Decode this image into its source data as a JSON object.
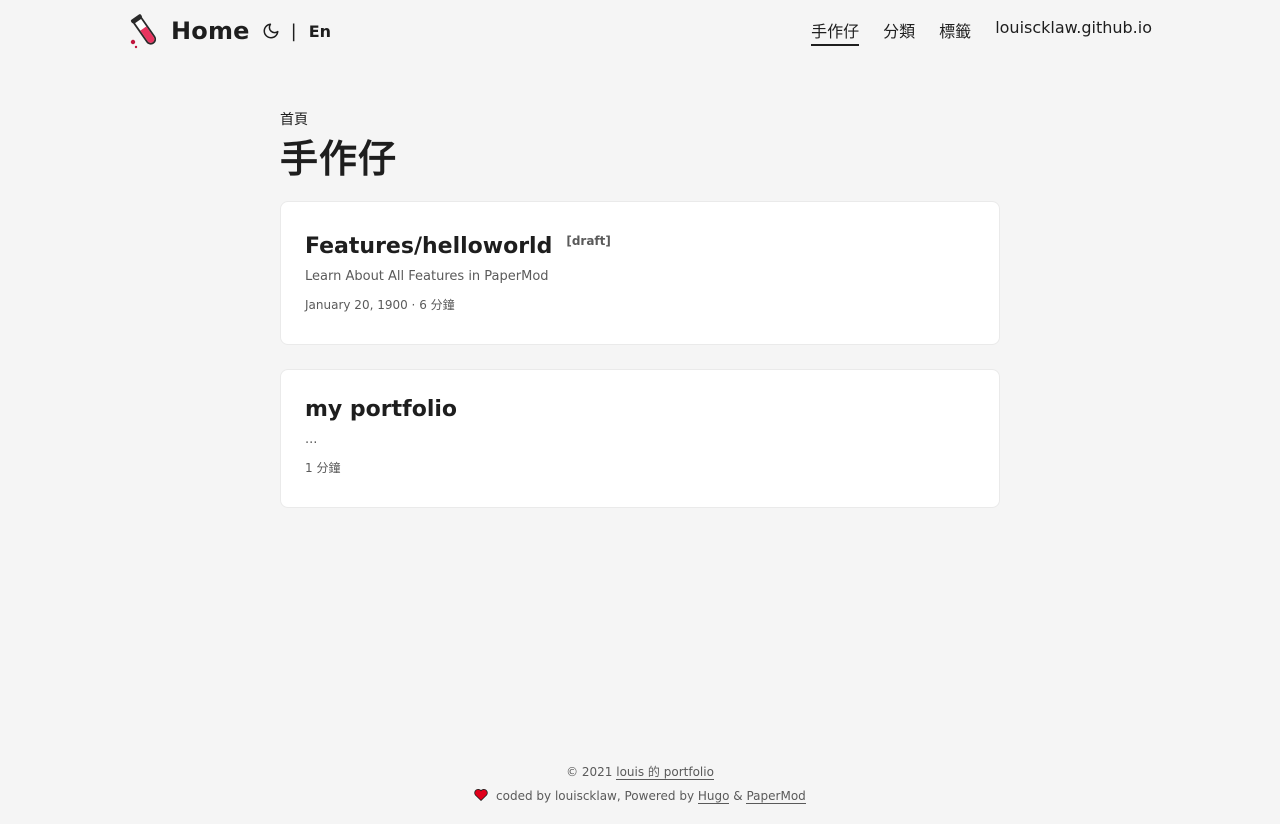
{
  "header": {
    "logo_text": "Home",
    "lang_separator": "|",
    "lang_label": "En",
    "nav": [
      {
        "label": "手作仔",
        "active": true
      },
      {
        "label": "分類",
        "active": false
      },
      {
        "label": "標籤",
        "active": false
      },
      {
        "label": "louiscklaw.github.io",
        "active": false
      }
    ]
  },
  "main": {
    "breadcrumb": "首頁",
    "title": "手作仔",
    "posts": [
      {
        "title": "Features/helloworld",
        "badge": "[draft]",
        "summary": "Learn About All Features in PaperMod",
        "meta": "January 20, 1900 · 6 分鐘"
      },
      {
        "title": "my portfolio",
        "badge": "",
        "summary": "...",
        "meta": "1 分鐘"
      }
    ]
  },
  "footer": {
    "copyright_prefix": "© 2021",
    "site_link": "louis 的 portfolio",
    "coded_by": "coded by louiscklaw, Powered by",
    "hugo_link": "Hugo",
    "amp": "&",
    "papermod_link": "PaperMod"
  },
  "colors": {
    "background": "#f5f5f5",
    "card": "#ffffff",
    "text_primary": "#1e1e1e",
    "text_secondary": "#5a5a5a",
    "heart": "#e0001b"
  }
}
